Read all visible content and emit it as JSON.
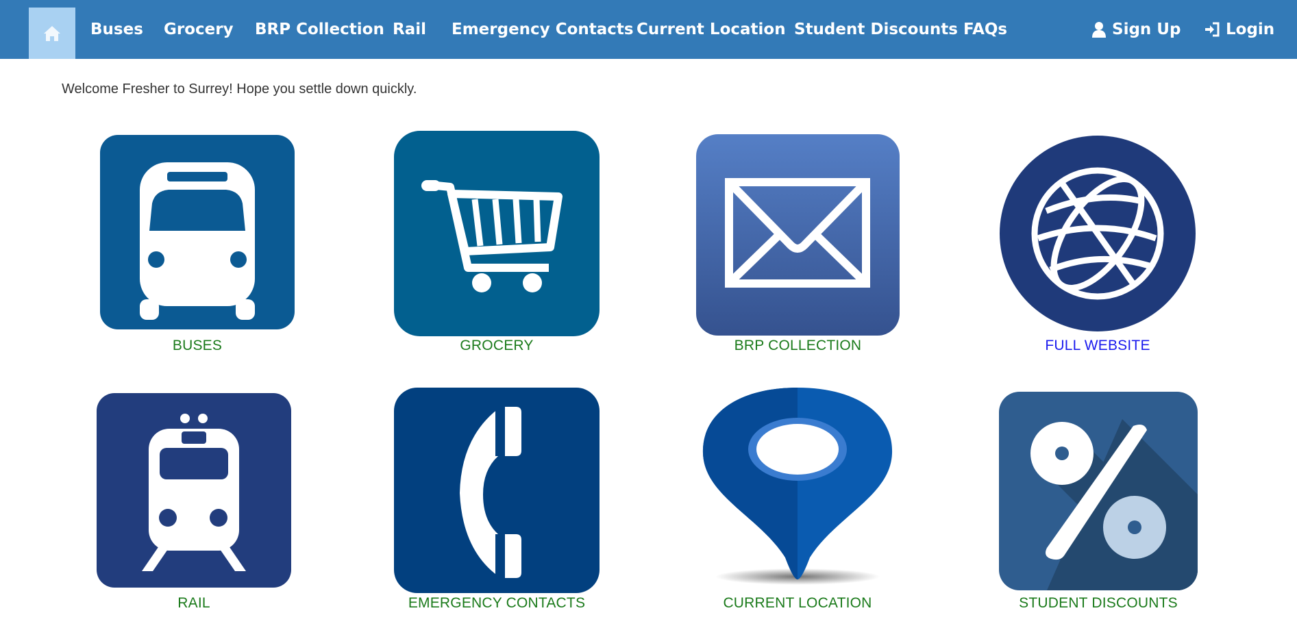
{
  "nav": {
    "home_icon": "home-icon",
    "items": [
      {
        "label": "Buses"
      },
      {
        "label": "Grocery"
      },
      {
        "label": "BRP Collection"
      },
      {
        "label": "Rail"
      },
      {
        "label": "Emergency Contacts"
      },
      {
        "label": "Current Location"
      },
      {
        "label": "Student Discounts"
      },
      {
        "label": "FAQs"
      }
    ],
    "signup": {
      "label": "Sign Up",
      "icon": "user-icon"
    },
    "login": {
      "label": "Login",
      "icon": "login-icon"
    }
  },
  "welcome_text": "Welcome Fresher to Surrey! Hope you settle down quickly.",
  "tiles": [
    {
      "label": "BUSES",
      "icon": "bus-icon",
      "color": "#0b5a93"
    },
    {
      "label": "GROCERY",
      "icon": "cart-icon",
      "color": "#02608f"
    },
    {
      "label": "BRP COLLECTION",
      "icon": "envelope-icon",
      "color": "#4a6db0"
    },
    {
      "label": "FULL WEBSITE",
      "icon": "globe-icon",
      "color": "#1f3a7a"
    },
    {
      "label": "RAIL",
      "icon": "train-icon",
      "color": "#223d7d"
    },
    {
      "label": "EMERGENCY CONTACTS",
      "icon": "phone-icon",
      "color": "#02407f"
    },
    {
      "label": "CURRENT LOCATION",
      "icon": "map-pin-icon",
      "color": "#0a5bb0"
    },
    {
      "label": "STUDENT DISCOUNTS",
      "icon": "percent-icon",
      "color": "#2f5d8f"
    }
  ],
  "colors": {
    "navbar": "#337ab7",
    "nav_active": "#a9d1f2",
    "caption_green": "#1a7a1a",
    "caption_link": "#1a1aee"
  }
}
